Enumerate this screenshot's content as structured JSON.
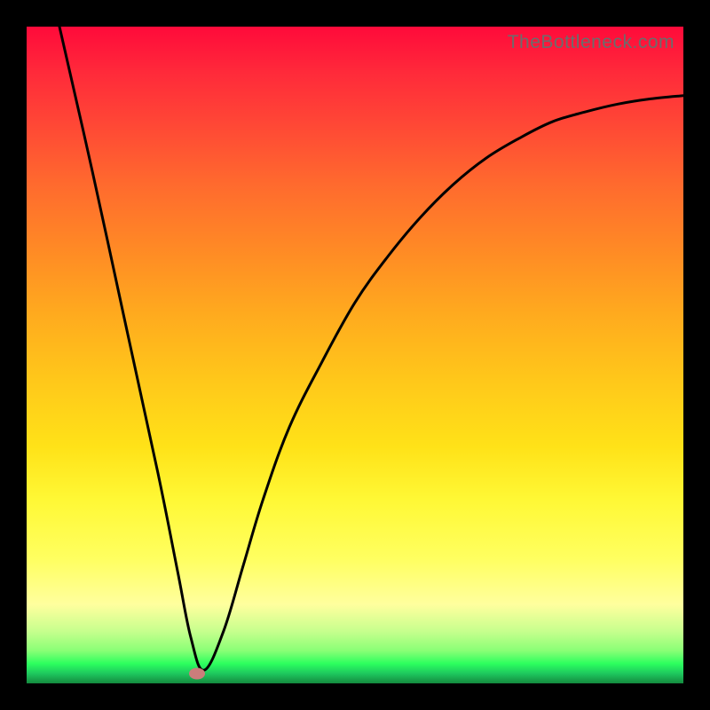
{
  "watermark": "TheBottleneck.com",
  "colors": {
    "frame": "#000000",
    "curve": "#000000",
    "marker": "#cb7d7b"
  },
  "chart_data": {
    "type": "line",
    "title": "",
    "xlabel": "",
    "ylabel": "",
    "xlim": [
      0,
      100
    ],
    "ylim": [
      0,
      100
    ],
    "grid": false,
    "legend": false,
    "series": [
      {
        "name": "bottleneck-curve",
        "x": [
          5,
          10,
          15,
          20,
          23,
          25,
          27,
          30,
          33,
          36,
          40,
          45,
          50,
          55,
          60,
          65,
          70,
          75,
          80,
          85,
          90,
          95,
          100
        ],
        "y": [
          100,
          78,
          55,
          32,
          17,
          7,
          2,
          8,
          18,
          28,
          39,
          49,
          58,
          65,
          71,
          76,
          80,
          83,
          85.5,
          87,
          88.2,
          89,
          89.5
        ]
      }
    ],
    "marker": {
      "x": 26,
      "y": 1.5
    },
    "background_gradient": {
      "direction": "vertical",
      "meaning": "top=high bottleneck (red), bottom=low bottleneck (green)",
      "stops": [
        {
          "pos": 0.0,
          "color": "#ff0a3a"
        },
        {
          "pos": 0.25,
          "color": "#ff6a2e"
        },
        {
          "pos": 0.5,
          "color": "#ffc81a"
        },
        {
          "pos": 0.8,
          "color": "#ffff60"
        },
        {
          "pos": 0.95,
          "color": "#8aff76"
        },
        {
          "pos": 1.0,
          "color": "#148a3e"
        }
      ]
    }
  }
}
